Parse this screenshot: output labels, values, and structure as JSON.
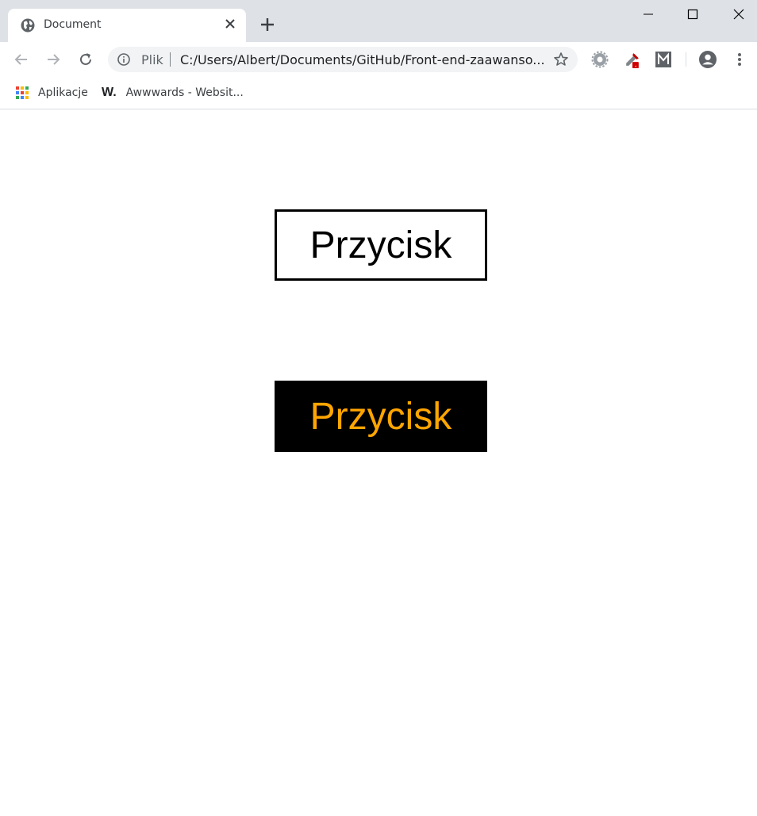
{
  "browser": {
    "tab": {
      "title": "Document",
      "icon": "globe-icon"
    },
    "address_bar": {
      "scheme_label": "Plik",
      "url": "C:/Users/Albert/Documents/GitHub/Front-end-zaawanso..."
    },
    "bookmarks": [
      {
        "label": "Aplikacje",
        "icon": "apps-grid-icon"
      },
      {
        "label": "Awwwards - Websit...",
        "icon": "awwwards-icon"
      }
    ]
  },
  "page": {
    "buttons": [
      {
        "label": "Przycisk",
        "style": "outline",
        "text_color": "#000000",
        "border_color": "#000000"
      },
      {
        "label": "Przycisk",
        "style": "filled",
        "background": "#000000",
        "text_color": "#ffa500"
      }
    ]
  }
}
